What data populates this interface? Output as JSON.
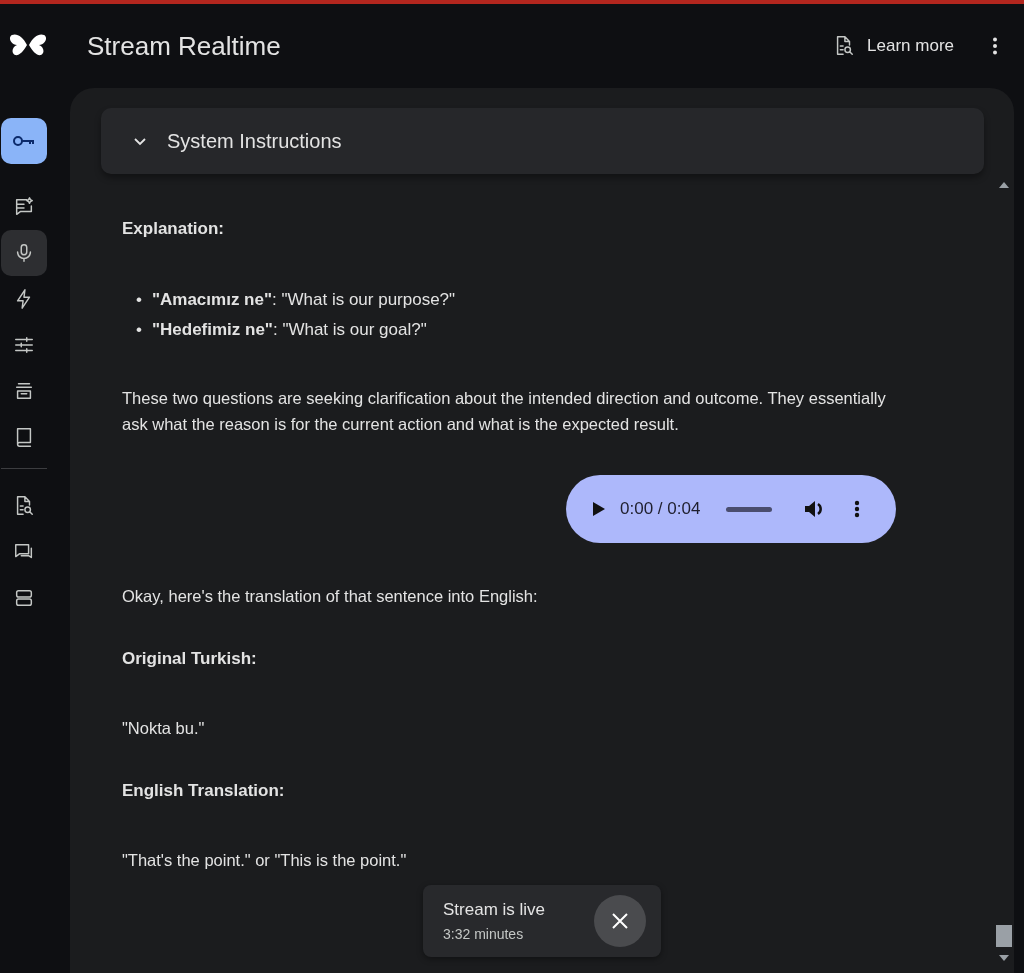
{
  "app": {
    "title": "Stream Realtime",
    "learn_more": "Learn more"
  },
  "sidebar": {
    "items": [
      {
        "kind": "key",
        "selected": true
      },
      {
        "kind": "nav",
        "selected": false
      },
      {
        "kind": "nav",
        "selected": true
      },
      {
        "kind": "nav",
        "selected": false
      },
      {
        "kind": "nav",
        "selected": false
      },
      {
        "kind": "nav",
        "selected": false
      },
      {
        "kind": "nav",
        "selected": false
      },
      {
        "kind": "divider"
      },
      {
        "kind": "nav",
        "selected": false
      },
      {
        "kind": "nav",
        "selected": false
      },
      {
        "kind": "nav",
        "selected": false
      }
    ]
  },
  "system_instructions": {
    "title": "System Instructions",
    "expanded": false
  },
  "messages": [
    {
      "kind": "heading",
      "text": "Explanation:"
    },
    {
      "kind": "bullets",
      "items": [
        {
          "marker": "•",
          "text": "**\"Amacımız ne\"**: \"What is our purpose?\""
        },
        {
          "marker": "•",
          "text": "**\"Hedefimiz ne\"**: \"What is our goal?\""
        }
      ]
    },
    {
      "kind": "paragraph",
      "text": "These two questions are seeking clarification about the intended direction and outcome. They essentially ask what the reason is for the current action and what is the expected result."
    },
    {
      "kind": "audio",
      "time": "0:00 / 0:04"
    },
    {
      "kind": "paragraph",
      "text": "Okay, here's the translation of that sentence into English:"
    },
    {
      "kind": "heading",
      "text": "Original Turkish:"
    },
    {
      "kind": "paragraph",
      "text": "\"Nokta bu.\""
    },
    {
      "kind": "heading",
      "text": "English Translation:"
    },
    {
      "kind": "paragraph",
      "text": "\"That's the point.\" or \"This is the point.\""
    }
  ],
  "toast": {
    "title": "Stream is live",
    "subtitle": "3:32 minutes"
  }
}
